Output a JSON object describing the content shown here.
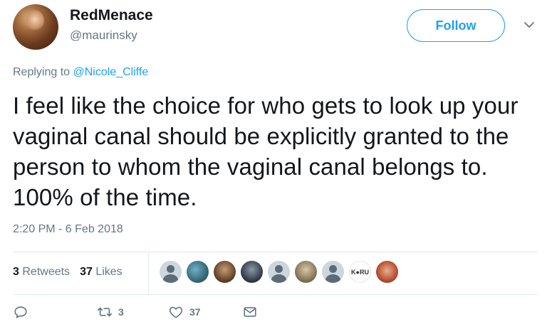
{
  "user": {
    "name": "RedMenace",
    "handle": "@maurinsky"
  },
  "follow_label": "Follow",
  "reply_context": {
    "prefix": "Replying to",
    "mention": "@Nicole_Cliffe"
  },
  "tweet_text": "I feel like the choice for who gets to look up your vaginal canal should be explicitly granted to the person to whom the vaginal canal belongs to. 100% of the time.",
  "timestamp": "2:20 PM - 6 Feb 2018",
  "stats": {
    "retweets_count": "3",
    "retweets_label": "Retweets",
    "likes_count": "37",
    "likes_label": "Likes"
  },
  "likers_badge_text": "K●RU",
  "actions": {
    "reply_icon": "reply-icon",
    "retweet_icon": "retweet-icon",
    "retweet_count": "3",
    "like_icon": "heart-icon",
    "like_count": "37",
    "dm_icon": "envelope-icon"
  },
  "colors": {
    "accent": "#1da1f2",
    "muted": "#657786",
    "text": "#14171a",
    "divider": "#e1e8ed"
  }
}
